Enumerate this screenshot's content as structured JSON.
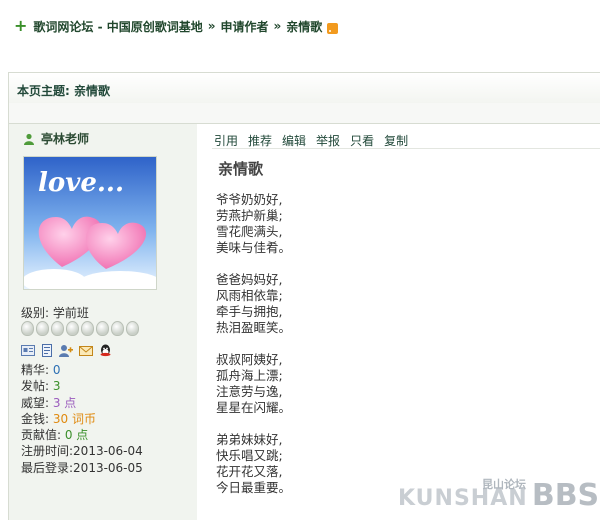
{
  "breadcrumb": {
    "items": [
      "歌词网论坛 - 中国原创歌词基地",
      "申请作者",
      "亲情歌"
    ],
    "separator": "»"
  },
  "topic": {
    "label": "本页主题: 亲情歌"
  },
  "author": {
    "name": "亭林老师",
    "avatar_text": "love...",
    "level": "级别: 学前班",
    "stars": 8,
    "stats": [
      {
        "label": "精华: ",
        "value": "0"
      },
      {
        "label": "发帖: ",
        "value": "3"
      },
      {
        "label": "威望: ",
        "value": "3 点"
      },
      {
        "label": "金钱: ",
        "value": "30 词币"
      },
      {
        "label": "贡献值: ",
        "value": "0 点"
      }
    ],
    "reg": "注册时间:2013-06-04",
    "last": "最后登录:2013-06-05"
  },
  "actions": [
    "引用",
    "推荐",
    "编辑",
    "举报",
    "只看",
    "复制"
  ],
  "post": {
    "title": "亲情歌",
    "stanzas": [
      [
        "爷爷奶奶好,",
        "劳燕护新巢;",
        "雪花爬满头,",
        "美味与佳肴。"
      ],
      [
        "爸爸妈妈好,",
        "风雨相依靠;",
        "牵手与拥抱,",
        "热泪盈眶笑。"
      ],
      [
        "叔叔阿姨好,",
        "孤舟海上漂;",
        "注意劳与逸,",
        "星星在闪耀。"
      ],
      [
        "弟弟妹妹好,",
        "快乐唱又跳;",
        "花开花又落,",
        "今日最重要。"
      ]
    ]
  },
  "watermark": {
    "cn": "昆山论坛",
    "en": "KUNSHAN",
    "bbs": "BBS"
  },
  "colors": {
    "accent": "#21472d",
    "sidebar": "#f1f4ef",
    "link": "#2c6fb3"
  }
}
